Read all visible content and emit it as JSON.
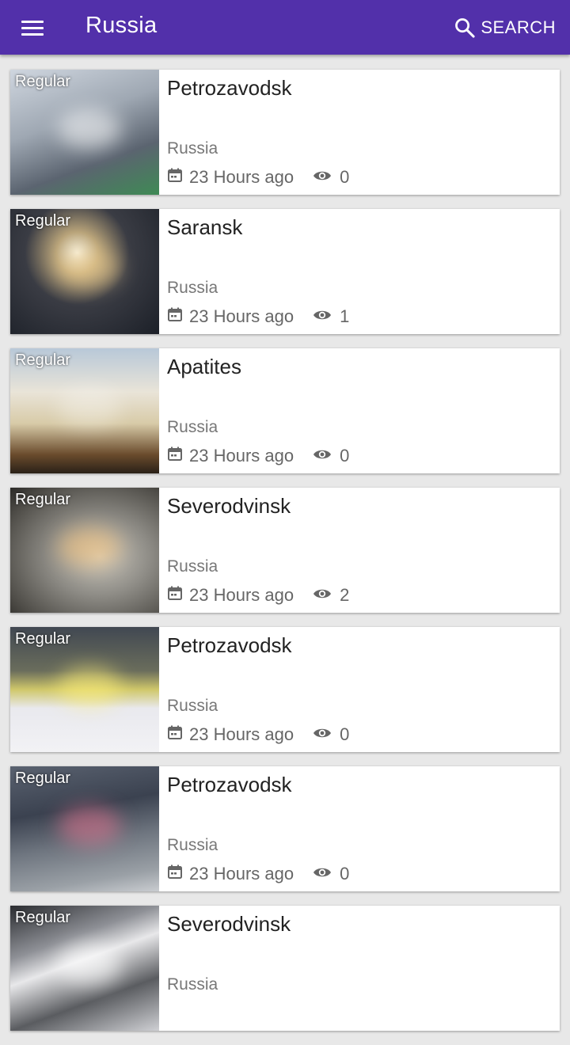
{
  "header": {
    "title": "Russia",
    "search_label": "SEARCH",
    "menu_icon": "hamburger-menu-icon",
    "search_icon": "search-icon",
    "background_color": "#5230aa"
  },
  "cards": [
    {
      "badge": "Regular",
      "city": "Petrozavodsk",
      "country": "Russia",
      "time": "23 Hours ago",
      "views": "0",
      "thumb": {
        "bg": "linear-gradient(160deg,#cfd6df 0%,#9fa8b3 40%,#5b6470 70%,#3f8a55 100%)",
        "glow": "rgba(255,255,255,0.55)"
      }
    },
    {
      "badge": "Regular",
      "city": "Saransk",
      "country": "Russia",
      "time": "23 Hours ago",
      "views": "1",
      "thumb": {
        "bg": "radial-gradient(ellipse at 45% 35%,#f3efe0 0%,#b9a47a 18%,#3a3c44 45%,#1c2028 100%)",
        "glow": "rgba(255,220,150,0.45)"
      }
    },
    {
      "badge": "Regular",
      "city": "Apatites",
      "country": "Russia",
      "time": "23 Hours ago",
      "views": "0",
      "thumb": {
        "bg": "linear-gradient(180deg,#b8c8d8 0%,#e9e4d8 35%,#d8cba8 60%,#6a4b2c 85%,#2a2118 100%)",
        "glow": "rgba(255,255,255,0.3)"
      }
    },
    {
      "badge": "Regular",
      "city": "Severodvinsk",
      "country": "Russia",
      "time": "23 Hours ago",
      "views": "2",
      "thumb": {
        "bg": "radial-gradient(ellipse at 60% 55%,#c9c6bd 0%,#8e8c86 40%,#4f4d48 80%,#2b2a27 100%)",
        "glow": "rgba(255,200,120,0.5)"
      }
    },
    {
      "badge": "Regular",
      "city": "Petrozavodsk",
      "country": "Russia",
      "time": "23 Hours ago",
      "views": "0",
      "thumb": {
        "bg": "linear-gradient(180deg,#414852 0%,#6a6d5c 35%,#cfc76a 50%,#e9e9ee 65%,#f2f2f5 100%)",
        "glow": "rgba(255,240,120,0.55)"
      }
    },
    {
      "badge": "Regular",
      "city": "Petrozavodsk",
      "country": "Russia",
      "time": "23 Hours ago",
      "views": "0",
      "thumb": {
        "bg": "linear-gradient(170deg,#5a6270 0%,#3b4250 35%,#6f7680 60%,#9aa0a6 85%,#c9ccd0 100%)",
        "glow": "rgba(255,120,150,0.45)"
      }
    },
    {
      "badge": "Regular",
      "city": "Severodvinsk",
      "country": "Russia",
      "time": "",
      "views": "",
      "thumb": {
        "bg": "linear-gradient(160deg,#2a2c30 0%,#8e9096 30%,#e8e8ea 45%,#5a5c60 70%,#cfd0d4 100%)",
        "glow": "rgba(255,255,255,0.6)"
      }
    }
  ]
}
